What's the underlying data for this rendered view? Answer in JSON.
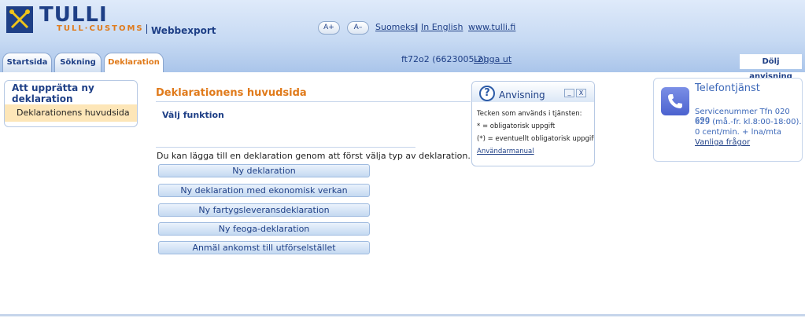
{
  "header": {
    "brand_title": "TULLI",
    "brand_subtitle": "TULL·CUSTOMS",
    "app_name": "Webbexport",
    "font_increase": "A+",
    "font_decrease": "A–",
    "lang_finnish": "Suomeksi",
    "lang_sep": "|",
    "lang_english": "In English",
    "site_link": "www.tulli.fi"
  },
  "tabs": [
    {
      "label": "Startsida"
    },
    {
      "label": "Sökning"
    },
    {
      "label": "Deklaration"
    }
  ],
  "user": {
    "info": "ft72o2 (6623005-2)",
    "logout": "Logga ut"
  },
  "hide_guide": "Dölj anvisning",
  "leftnav": {
    "title": "Att upprätta ny deklaration",
    "item": "Deklarationens huvudsida"
  },
  "main": {
    "title": "Deklarationens huvudsida",
    "function_label": "Välj funktion",
    "instruction": "Du kan lägga till en deklaration genom att först välja typ av deklaration.",
    "buttons": [
      {
        "label": "Ny deklaration"
      },
      {
        "label": "Ny deklaration med ekonomisk verkan"
      },
      {
        "label": "Ny fartygsleveransdeklaration"
      },
      {
        "label": "Ny feoga-deklaration"
      },
      {
        "label": "Anmäl ankomst till utförselstället"
      }
    ]
  },
  "guide": {
    "title": "Anvisning",
    "min": "_",
    "close": "X",
    "line1": "Tecken som används i tjänsten:",
    "line2": "* = obligatorisk uppgift",
    "line3": "(*) = eventuellt obligatorisk uppgift",
    "manual": "Användarmanual"
  },
  "phone": {
    "title": "Telefontjänst",
    "line1": "Servicenummer Tfn 020 690",
    "line2": "629 (må.-fr. kl.8:00-18:00).",
    "line3": "0 cent/min. + lna/mta",
    "faq": "Vanliga frågor"
  },
  "colors": {
    "brand_blue": "#1e3f86",
    "accent_orange": "#e07a1a",
    "highlight": "#fde6b8"
  }
}
